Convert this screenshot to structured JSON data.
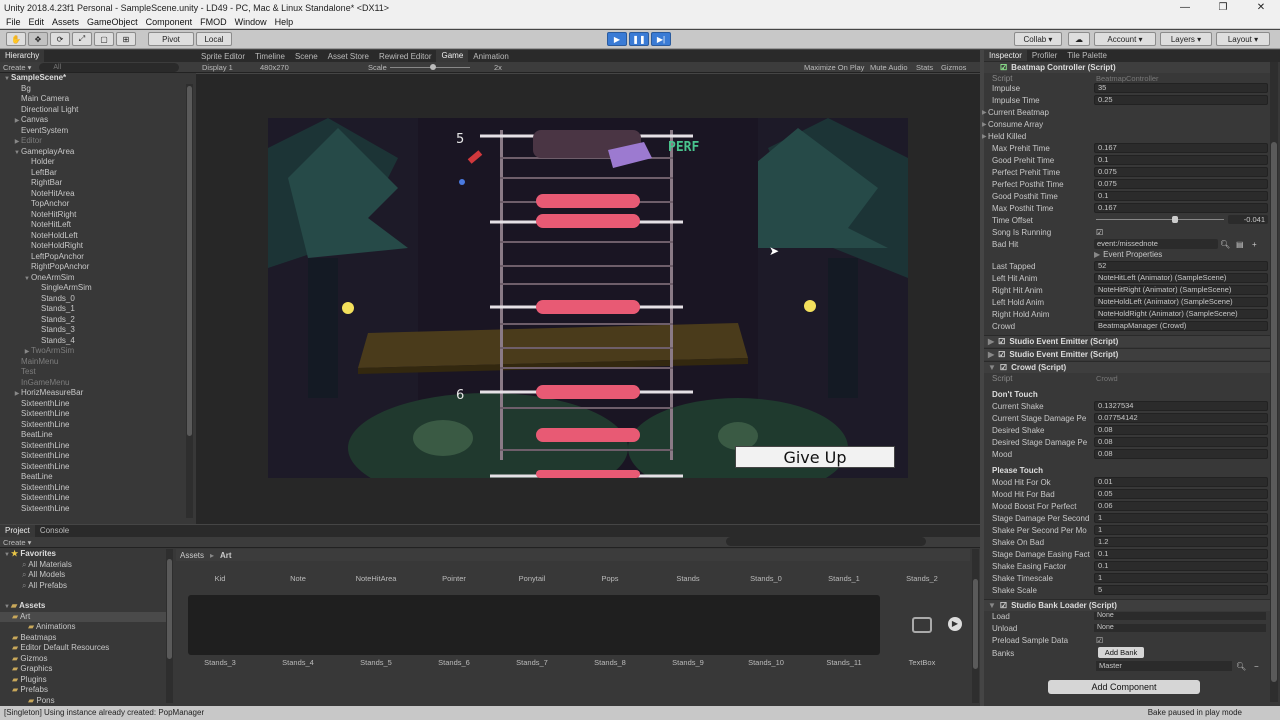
{
  "window": {
    "title": "Unity 2018.4.23f1 Personal - SampleScene.unity - LD49 - PC, Mac & Linux Standalone* <DX11>",
    "controls": [
      "—",
      "❐",
      "✕"
    ]
  },
  "menu": [
    "File",
    "Edit",
    "Assets",
    "GameObject",
    "Component",
    "FMOD",
    "Window",
    "Help"
  ],
  "toolbar": {
    "pivot": "Pivot",
    "local": "Local",
    "collab": "Collab ▾",
    "account": "Account",
    "layers": "Layers",
    "layout": "Layout"
  },
  "hierarchy": {
    "tab": "Hierarchy",
    "create": "Create ▾",
    "search_placeholder": "All",
    "scene": "SampleScene*",
    "items": [
      {
        "label": "Bg",
        "indent": 1
      },
      {
        "label": "Main Camera",
        "indent": 1
      },
      {
        "label": "Directional Light",
        "indent": 1
      },
      {
        "label": "Canvas",
        "indent": 1,
        "arrow": true
      },
      {
        "label": "EventSystem",
        "indent": 1
      },
      {
        "label": "Editor",
        "indent": 1,
        "arrow": true,
        "dim": true
      },
      {
        "label": "GameplayArea",
        "indent": 1,
        "arrow": true,
        "open": true
      },
      {
        "label": "Holder",
        "indent": 2
      },
      {
        "label": "LeftBar",
        "indent": 2
      },
      {
        "label": "RightBar",
        "indent": 2
      },
      {
        "label": "NoteHitArea",
        "indent": 2
      },
      {
        "label": "TopAnchor",
        "indent": 2
      },
      {
        "label": "NoteHitRight",
        "indent": 2
      },
      {
        "label": "NoteHitLeft",
        "indent": 2
      },
      {
        "label": "NoteHoldLeft",
        "indent": 2
      },
      {
        "label": "NoteHoldRight",
        "indent": 2
      },
      {
        "label": "LeftPopAnchor",
        "indent": 2
      },
      {
        "label": "RightPopAnchor",
        "indent": 2
      },
      {
        "label": "OneArmSim",
        "indent": 2,
        "arrow": true,
        "open": true
      },
      {
        "label": "SingleArmSim",
        "indent": 3
      },
      {
        "label": "Stands_0",
        "indent": 3
      },
      {
        "label": "Stands_1",
        "indent": 3
      },
      {
        "label": "Stands_2",
        "indent": 3
      },
      {
        "label": "Stands_3",
        "indent": 3
      },
      {
        "label": "Stands_4",
        "indent": 3
      },
      {
        "label": "TwoArmSim",
        "indent": 2,
        "arrow": true,
        "dim": true
      },
      {
        "label": "MainMenu",
        "indent": 1,
        "dim": true
      },
      {
        "label": "Test",
        "indent": 1,
        "dim": true
      },
      {
        "label": "InGameMenu",
        "indent": 1,
        "dim": true
      },
      {
        "label": "HorizMeasureBar",
        "indent": 1,
        "arrow": true
      },
      {
        "label": "SixteenthLine",
        "indent": 1
      },
      {
        "label": "SixteenthLine",
        "indent": 1
      },
      {
        "label": "SixteenthLine",
        "indent": 1
      },
      {
        "label": "BeatLine",
        "indent": 1
      },
      {
        "label": "SixteenthLine",
        "indent": 1
      },
      {
        "label": "SixteenthLine",
        "indent": 1
      },
      {
        "label": "SixteenthLine",
        "indent": 1
      },
      {
        "label": "BeatLine",
        "indent": 1
      },
      {
        "label": "SixteenthLine",
        "indent": 1
      },
      {
        "label": "SixteenthLine",
        "indent": 1
      },
      {
        "label": "SixteenthLine",
        "indent": 1
      }
    ]
  },
  "center_tabs": [
    "Sprite Editor",
    "Timeline",
    "Scene",
    "Asset Store",
    "Rewired Editor",
    "Game",
    "Animation"
  ],
  "game_view": {
    "display": "Display 1",
    "resolution": "480x270",
    "scale_label": "Scale",
    "scale_value": "2x",
    "options": [
      "Maximize On Play",
      "Mute Audio",
      "Stats",
      "Gizmos"
    ],
    "measure_top": "5",
    "measure_bottom": "6",
    "perf_text": "PERF",
    "give_up": "Give Up"
  },
  "inspector": {
    "tabs": [
      "Inspector",
      "Profiler",
      "Tile Palette"
    ],
    "beatmap_header": "Beatmap Controller (Script)",
    "beatmap_script_label": "Script",
    "beatmap_script": "BeatmapController",
    "beatmap_rows": [
      {
        "label": "Impulse",
        "value": "35"
      },
      {
        "label": "Impulse Time",
        "value": "0.25"
      },
      {
        "label": "Current Beatmap",
        "value": ""
      },
      {
        "label": "Consume Array",
        "value": ""
      },
      {
        "label": "Held Killed",
        "value": ""
      },
      {
        "label": "Max Prehit Time",
        "value": "0.167"
      },
      {
        "label": "Good Prehit Time",
        "value": "0.1"
      },
      {
        "label": "Perfect Prehit Time",
        "value": "0.075"
      },
      {
        "label": "Perfect Posthit Time",
        "value": "0.075"
      },
      {
        "label": "Good Posthit Time",
        "value": "0.1"
      },
      {
        "label": "Max Posthit Time",
        "value": "0.167"
      }
    ],
    "time_offset_label": "Time Offset",
    "time_offset_value": "-0.041",
    "song_running_label": "Song Is Running",
    "bad_hit_label": "Bad Hit",
    "bad_hit_value": "event:/missednote",
    "event_props": "Event Properties",
    "rows2": [
      {
        "label": "Last Tapped",
        "value": "52"
      },
      {
        "label": "Left Hit Anim",
        "value": "NoteHitLeft (Animator) (SampleScene)"
      },
      {
        "label": "Right Hit Anim",
        "value": "NoteHitRight (Animator) (SampleScene)"
      },
      {
        "label": "Left Hold Anim",
        "value": "NoteHoldLeft (Animator) (SampleScene)"
      },
      {
        "label": "Right Hold Anim",
        "value": "NoteHoldRight (Animator) (SampleScene)"
      },
      {
        "label": "Crowd",
        "value": "BeatmapManager (Crowd)"
      }
    ],
    "emitter1": "Studio Event Emitter (Script)",
    "emitter2": "Studio Event Emitter (Script)",
    "crowd_header": "Crowd (Script)",
    "crowd_script_label": "Script",
    "crowd_script": "Crowd",
    "dont_touch": "Don't Touch",
    "crowd_rows": [
      {
        "label": "Current Shake",
        "value": "0.1327534"
      },
      {
        "label": "Current Stage Damage Pe",
        "value": "0.07754142"
      },
      {
        "label": "Desired Shake",
        "value": "0.08"
      },
      {
        "label": "Desired Stage Damage Pe",
        "value": "0.08"
      },
      {
        "label": "Mood",
        "value": "0.08"
      }
    ],
    "please_touch": "Please Touch",
    "crowd_rows2": [
      {
        "label": "Mood Hit For Ok",
        "value": "0.01"
      },
      {
        "label": "Mood Hit For Bad",
        "value": "0.05"
      },
      {
        "label": "Mood Boost For Perfect",
        "value": "0.06"
      },
      {
        "label": "Stage Damage Per Second",
        "value": "1"
      },
      {
        "label": "Shake Per Second Per Mo",
        "value": "1"
      },
      {
        "label": "Shake On Bad",
        "value": "1.2"
      },
      {
        "label": "Stage Damage Easing Fact",
        "value": "0.1"
      },
      {
        "label": "Shake Easing Factor",
        "value": "0.1"
      },
      {
        "label": "Shake Timescale",
        "value": "1"
      },
      {
        "label": "Shake Scale",
        "value": "5"
      }
    ],
    "bank_header": "Studio Bank Loader (Script)",
    "load_label": "Load",
    "load_value": "None",
    "unload_label": "Unload",
    "unload_value": "None",
    "preload_label": "Preload Sample Data",
    "banks_label": "Banks",
    "add_bank": "Add Bank",
    "master": "Master",
    "add_component": "Add Component"
  },
  "project": {
    "tabs": [
      "Project",
      "Console"
    ],
    "create": "Create ▾",
    "favorites": "Favorites",
    "fav_items": [
      "All Materials",
      "All Models",
      "All Prefabs"
    ],
    "assets": "Assets",
    "asset_tree": [
      "Art",
      "Animations",
      "Beatmaps",
      "Editor Default Resources",
      "Gizmos",
      "Graphics",
      "Plugins",
      "Prefabs",
      "Pons"
    ],
    "breadcrumb_root": "Assets",
    "breadcrumb_sep": "▸",
    "breadcrumb_leaf": "Art",
    "row1": [
      "Kid",
      "Note",
      "NoteHitArea",
      "Pointer",
      "Ponytail",
      "Pops",
      "Stands",
      "Stands_0",
      "Stands_1",
      "Stands_2"
    ],
    "row2": [
      "Stands_3",
      "Stands_4",
      "Stands_5",
      "Stands_6",
      "Stands_7",
      "Stands_8",
      "Stands_9",
      "Stands_10",
      "Stands_11",
      "TextBox"
    ]
  },
  "status": {
    "message": "[Singleton] Using instance already created: PopManager",
    "right": "Bake paused in play mode"
  }
}
